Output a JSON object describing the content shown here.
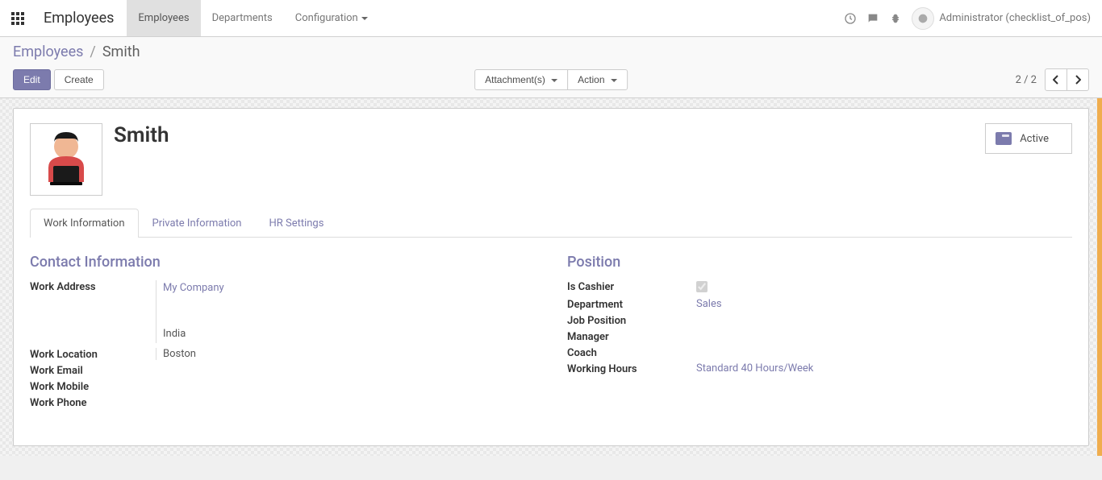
{
  "nav": {
    "app_title": "Employees",
    "menu": [
      {
        "label": "Employees",
        "active": true
      },
      {
        "label": "Departments"
      },
      {
        "label": "Configuration",
        "caret": true
      }
    ],
    "user_name": "Administrator (checklist_of_pos)"
  },
  "breadcrumb": {
    "parent": "Employees",
    "current": "Smith"
  },
  "cp": {
    "edit": "Edit",
    "create": "Create",
    "attachments": "Attachment(s)",
    "action": "Action",
    "pager": "2 / 2"
  },
  "record": {
    "name": "Smith",
    "active_label": "Active",
    "tabs": {
      "work_info": "Work Information",
      "private_info": "Private Information",
      "hr_settings": "HR Settings"
    },
    "contact": {
      "section": "Contact Information",
      "labels": {
        "work_address": "Work Address",
        "work_location": "Work Location",
        "work_email": "Work Email",
        "work_mobile": "Work Mobile",
        "work_phone": "Work Phone"
      },
      "work_address_company": "My Company",
      "work_address_country": "India",
      "work_location": "Boston"
    },
    "position": {
      "section": "Position",
      "labels": {
        "is_cashier": "Is Cashier",
        "department": "Department",
        "job_position": "Job Position",
        "manager": "Manager",
        "coach": "Coach",
        "working_hours": "Working Hours"
      },
      "is_cashier": true,
      "department": "Sales",
      "working_hours": "Standard 40 Hours/Week"
    }
  }
}
